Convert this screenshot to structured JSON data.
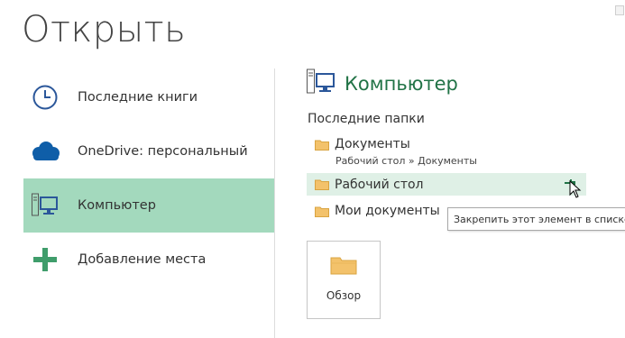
{
  "page": {
    "title": "Открыть"
  },
  "places": [
    {
      "label": "Последние книги",
      "icon": "clock-icon",
      "selected": false
    },
    {
      "label": "OneDrive: персональный",
      "icon": "onedrive-cloud-icon",
      "selected": false
    },
    {
      "label": "Компьютер",
      "icon": "computer-icon",
      "selected": true
    },
    {
      "label": "Добавление места",
      "icon": "add-place-plus-icon",
      "selected": false
    }
  ],
  "right": {
    "title": "Компьютер",
    "section_label": "Последние папки",
    "folders": [
      {
        "name": "Документы",
        "path": "Рабочий стол » Документы"
      },
      {
        "name": "Рабочий стол",
        "hover": true
      },
      {
        "name": "Мои документы"
      }
    ],
    "tooltip": "Закрепить этот элемент в списке",
    "browse_label": "Обзор"
  },
  "colors": {
    "accent": "#217346",
    "selected_bg": "#a3d9bd",
    "hover_bg": "#dff0e6",
    "folder": "#f3c26b"
  }
}
